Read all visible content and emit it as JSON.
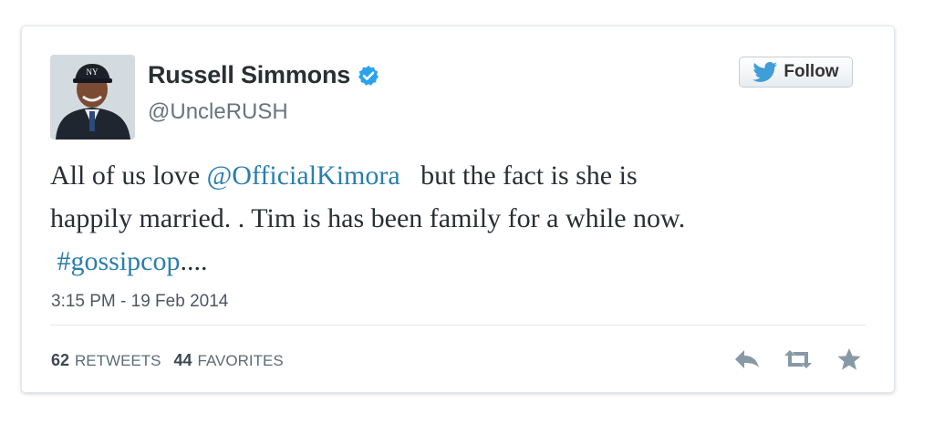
{
  "user": {
    "display_name": "Russell Simmons",
    "handle": "@UncleRUSH",
    "verified": true,
    "avatar_icon": "profile-photo"
  },
  "follow_button": {
    "label": "Follow",
    "icon": "twitter-bird-icon"
  },
  "tweet": {
    "line1_before": "All of us love ",
    "mention": "@OfficialKimora",
    "line1_after": "   but the fact is she is",
    "line2": "happily married. . Tim is has been family for a while now.",
    "hashtag": "#gossipcop",
    "trailing": "...."
  },
  "timestamp": "3:15 PM - 19 Feb 2014",
  "stats": {
    "retweets_count": "62",
    "retweets_label": "RETWEETS",
    "favorites_count": "44",
    "favorites_label": "FAVORITES"
  },
  "actions": [
    "reply-icon",
    "retweet-icon",
    "favorite-star-icon"
  ],
  "colors": {
    "link": "#2a7ead",
    "verified": "#2aa3ef",
    "text": "#292f33",
    "muted": "#66757f",
    "icon": "#8899a6"
  }
}
